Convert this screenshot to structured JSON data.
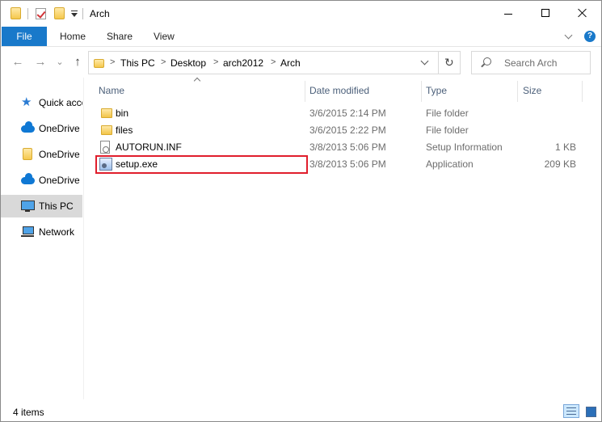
{
  "window": {
    "title": "Arch",
    "controls": [
      "minimize-icon",
      "maximize-icon",
      "close-icon"
    ]
  },
  "ribbon": {
    "file_label": "File",
    "tabs": [
      {
        "label": "Home"
      },
      {
        "label": "Share"
      },
      {
        "label": "View"
      }
    ],
    "help_glyph": "?"
  },
  "navigation": {
    "back_glyph": "←",
    "forward_glyph": "→",
    "recent_glyph": "⌄",
    "up_glyph": "↑",
    "refresh_glyph": "↻",
    "breadcrumbs": [
      {
        "label": "This PC"
      },
      {
        "label": "Desktop"
      },
      {
        "label": "arch2012"
      },
      {
        "label": "Arch"
      }
    ],
    "crumb_separator": ">",
    "search_placeholder": "Search Arch"
  },
  "sidebar": {
    "items": [
      {
        "label": "Quick access",
        "icon": "star-icon"
      },
      {
        "label": "OneDrive",
        "icon": "cloud-icon"
      },
      {
        "label": "OneDrive",
        "icon": "folder-icon"
      },
      {
        "label": "OneDrive",
        "icon": "cloud-icon"
      },
      {
        "label": "This PC",
        "icon": "computer-icon",
        "selected": true
      },
      {
        "label": "Network",
        "icon": "network-icon"
      }
    ]
  },
  "file_list": {
    "columns": {
      "name": "Name",
      "date": "Date modified",
      "type": "Type",
      "size": "Size"
    },
    "rows": [
      {
        "name": "bin",
        "date": "3/6/2015 2:14 PM",
        "type": "File folder",
        "size": "",
        "icon": "folder-icon"
      },
      {
        "name": "files",
        "date": "3/6/2015 2:22 PM",
        "type": "File folder",
        "size": "",
        "icon": "folder-icon"
      },
      {
        "name": "AUTORUN.INF",
        "date": "3/8/2013 5:06 PM",
        "type": "Setup Information",
        "size": "1 KB",
        "icon": "inf-file-icon"
      },
      {
        "name": "setup.exe",
        "date": "3/8/2013 5:06 PM",
        "type": "Application",
        "size": "209 KB",
        "icon": "setup-exe-icon",
        "highlighted": true
      }
    ]
  },
  "statusbar": {
    "item_count": "4 items"
  },
  "colors": {
    "accent": "#1979ca",
    "highlight_box": "#e01e2c",
    "selected_nav": "#d9d9d9"
  }
}
